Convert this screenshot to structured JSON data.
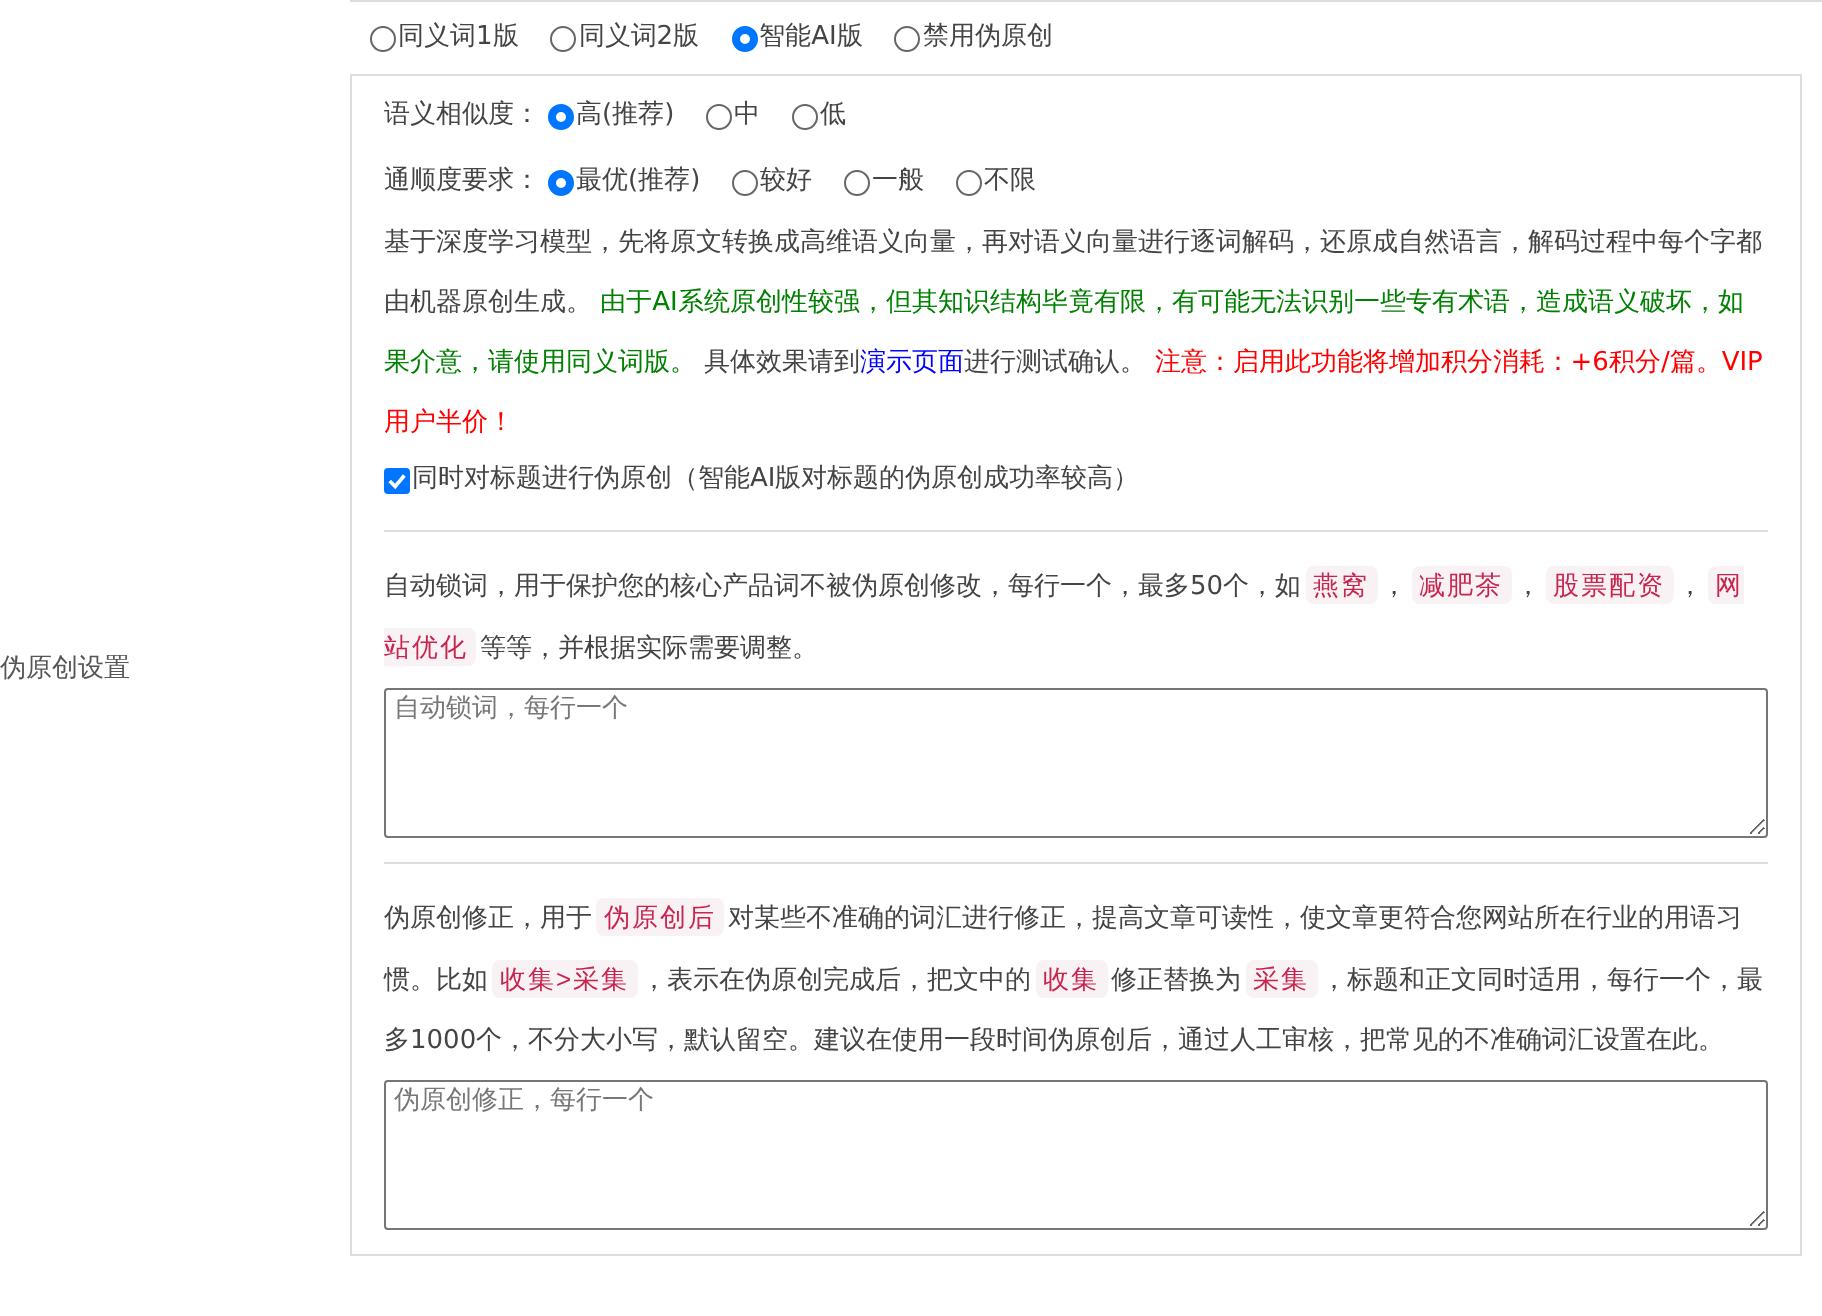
{
  "side_label": "伪原创设置",
  "modes": [
    {
      "label": "同义词1版",
      "selected": false
    },
    {
      "label": "同义词2版",
      "selected": false
    },
    {
      "label": "智能AI版",
      "selected": true
    },
    {
      "label": "禁用伪原创",
      "selected": false
    }
  ],
  "similarity": {
    "label": "语义相似度：",
    "options": [
      {
        "label": "高(推荐)",
        "selected": true
      },
      {
        "label": "中",
        "selected": false
      },
      {
        "label": "低",
        "selected": false
      }
    ]
  },
  "fluency": {
    "label": "通顺度要求：",
    "options": [
      {
        "label": "最优(推荐)",
        "selected": true
      },
      {
        "label": "较好",
        "selected": false
      },
      {
        "label": "一般",
        "selected": false
      },
      {
        "label": "不限",
        "selected": false
      }
    ]
  },
  "description": [
    {
      "kind": "text",
      "text": "基于深度学习模型，先将原文转换成高维语义向量，再对语义向量进行逐词解码，还原成自然语言，解码过程中每个字都由机器原创生成。 "
    },
    {
      "kind": "green",
      "text": "由于AI系统原创性较强，但其知识结构毕竟有限，有可能无法识别一些专有术语，造成语义破坏，如果介意，请使用同义词版。"
    },
    {
      "kind": "text",
      "text": " 具体效果请到"
    },
    {
      "kind": "link",
      "text": "演示页面"
    },
    {
      "kind": "text",
      "text": "进行测试确认。 "
    },
    {
      "kind": "red",
      "text": "注意：启用此功能将增加积分消耗：+6积分/篇。VIP用户半价！"
    }
  ],
  "title_option": {
    "label": "同时对标题进行伪原创（智能AI版对标题的伪原创成功率较高）",
    "checked": true
  },
  "lock_words": {
    "description": [
      {
        "kind": "text",
        "text": "自动锁词，用于保护您的核心产品词不被伪原创修改，每行一个，最多50个，如"
      },
      {
        "kind": "tag",
        "text": "燕窝"
      },
      {
        "kind": "text",
        "text": "，"
      },
      {
        "kind": "tag",
        "text": "减肥茶"
      },
      {
        "kind": "text",
        "text": "，"
      },
      {
        "kind": "tag",
        "text": "股票配资"
      },
      {
        "kind": "text",
        "text": "，"
      },
      {
        "kind": "tag",
        "text": "网站优化"
      },
      {
        "kind": "text",
        "text": "等等，并根据实际需要调整。"
      }
    ],
    "placeholder": "自动锁词，每行一个"
  },
  "correction": {
    "description": [
      {
        "kind": "text",
        "text": "伪原创修正，用于"
      },
      {
        "kind": "tag",
        "text": "伪原创后"
      },
      {
        "kind": "text",
        "text": "对某些不准确的词汇进行修正，提高文章可读性，使文章更符合您网站所在行业的用语习惯。比如"
      },
      {
        "kind": "tag",
        "text": "收集>采集"
      },
      {
        "kind": "text",
        "text": "，表示在伪原创完成后，把文中的"
      },
      {
        "kind": "tag",
        "text": "收集"
      },
      {
        "kind": "text",
        "text": "修正替换为"
      },
      {
        "kind": "tag",
        "text": "采集"
      },
      {
        "kind": "text",
        "text": "，标题和正文同时适用，每行一个，最多1000个，不分大小写，默认留空。建议在使用一段时间伪原创后，通过人工审核，把常见的不准确词汇设置在此。"
      }
    ],
    "placeholder": "伪原创修正，每行一个"
  }
}
